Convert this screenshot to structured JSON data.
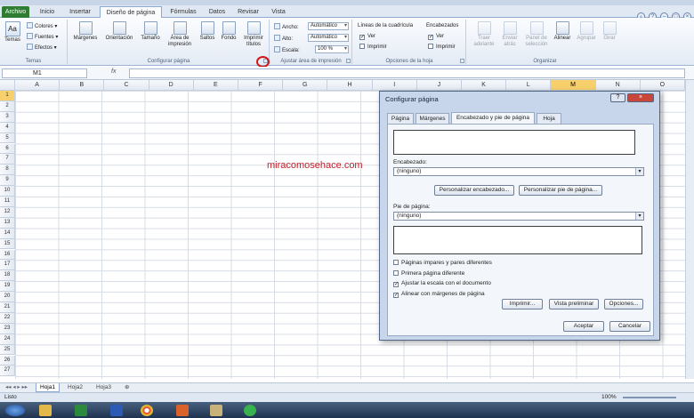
{
  "tabs": {
    "file": "Archivo",
    "items": [
      "Inicio",
      "Insertar",
      "Diseño de página",
      "Fórmulas",
      "Datos",
      "Revisar",
      "Vista"
    ]
  },
  "ribbon": {
    "temas": {
      "label": "Temas",
      "btn": "Temas",
      "colores": "Colores",
      "fuentes": "Fuentes",
      "efectos": "Efectos"
    },
    "configurar": {
      "label": "Configurar página",
      "margenes": "Márgenes",
      "orientacion": "Orientación",
      "tamano": "Tamaño",
      "area": "Área de impresión",
      "saltos": "Saltos",
      "fondo": "Fondo",
      "imprimir": "Imprimir títulos"
    },
    "ajustar": {
      "label": "Ajustar área de impresión",
      "ancho_label": "Ancho:",
      "ancho_value": "Automático",
      "alto_label": "Alto:",
      "alto_value": "Automático",
      "escala_label": "Escala:",
      "escala_value": "100 %"
    },
    "opciones": {
      "label": "Opciones de la hoja",
      "lineas": "Líneas de la cuadrícula",
      "encabezados": "Encabezados",
      "ver": "Ver",
      "imprimir": "Imprimir"
    },
    "organizar": {
      "label": "Organizar",
      "traer": "Traer adelante",
      "enviar": "Enviar atrás",
      "panel": "Panel de selección",
      "alinear": "Alinear",
      "agrupar": "Agrupar",
      "girar": "Girar"
    }
  },
  "formula_bar": {
    "name_box": "M1",
    "fx": "fx"
  },
  "columns": [
    "A",
    "B",
    "C",
    "D",
    "E",
    "F",
    "G",
    "H",
    "I",
    "J",
    "K",
    "L",
    "M",
    "N",
    "O"
  ],
  "selected_column": "M",
  "rows": [
    "1",
    "2",
    "3",
    "4",
    "5",
    "6",
    "7",
    "8",
    "9",
    "10",
    "11",
    "12",
    "13",
    "14",
    "15",
    "16",
    "17",
    "18",
    "19",
    "20",
    "21",
    "22",
    "23",
    "24",
    "25",
    "26",
    "27"
  ],
  "watermark": "miracomosehace.com",
  "sheets": [
    "Hoja1",
    "Hoja2",
    "Hoja3"
  ],
  "status": {
    "left": "Listo",
    "zoom": "100%"
  },
  "dialog": {
    "title": "Configurar página",
    "tabs": [
      "Página",
      "Márgenes",
      "Encabezado y pie de página",
      "Hoja"
    ],
    "encabezado_label": "Encabezado:",
    "encabezado_value": "(ninguno)",
    "btn_personalizar_enc": "Personalizar encabezado...",
    "btn_personalizar_pie": "Personalizar pie de página...",
    "pie_label": "Pie de página:",
    "pie_value": "(ninguno)",
    "checks": [
      {
        "label": "Páginas impares y pares diferentes",
        "checked": false
      },
      {
        "label": "Primera página diferente",
        "checked": false
      },
      {
        "label": "Ajustar la escala con el documento",
        "checked": true
      },
      {
        "label": "Alinear con márgenes de página",
        "checked": true
      }
    ],
    "btn_imprimir": "Imprimir...",
    "btn_vista": "Vista preliminar",
    "btn_opciones": "Opciones...",
    "btn_aceptar": "Aceptar",
    "btn_cancelar": "Cancelar"
  }
}
